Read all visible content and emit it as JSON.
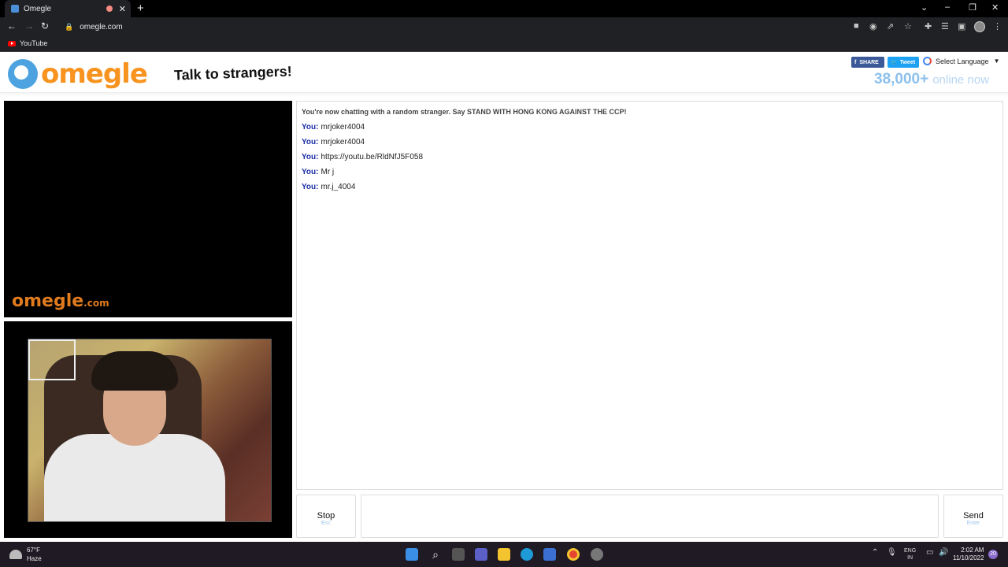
{
  "browser": {
    "tab_title": "Omegle",
    "url": "omegle.com",
    "bookmark": "YouTube"
  },
  "header": {
    "logo_text": "omegle",
    "tagline": "Talk to strangers!",
    "share_fb": "SHARE",
    "share_tw": "Tweet",
    "language": "Select Language",
    "online_count": "38,000+",
    "online_label": "online now"
  },
  "video": {
    "watermark": "omegle",
    "watermark_suffix": ".com"
  },
  "chat": {
    "system_message": "You're now chatting with a random stranger. Say STAND WITH HONG KONG AGAINST THE CCP!",
    "you_label": "You:",
    "messages": [
      "mrjoker4004",
      "mrjoker4004",
      "https://youtu.be/RldNfJ5F058",
      "Mr j",
      "mr.j_4004"
    ]
  },
  "controls": {
    "stop_label": "Stop",
    "stop_key": "Esc",
    "send_label": "Send",
    "send_key": "Enter",
    "message_value": ""
  },
  "taskbar": {
    "temp": "67°F",
    "weather": "Haze",
    "lang": "ENG",
    "region": "IN",
    "time": "2:02 AM",
    "date": "11/10/2022",
    "notifications": "20"
  },
  "colors": {
    "brand_orange": "#f7931e",
    "brand_blue": "#4da3e0",
    "you_blue": "#1b2ea6"
  }
}
